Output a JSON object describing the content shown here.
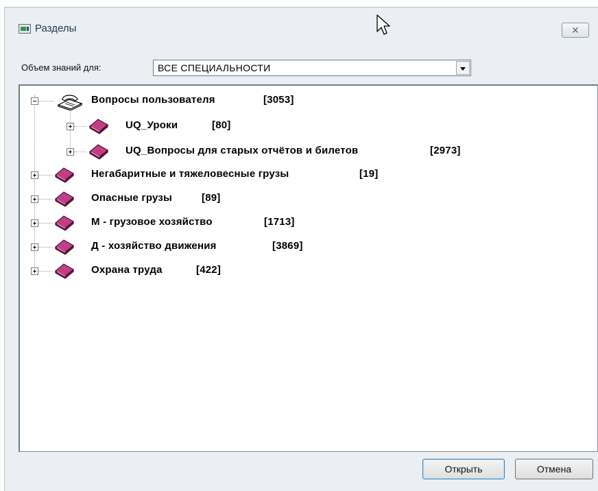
{
  "window": {
    "title": "Разделы",
    "close_symbol": "✕"
  },
  "scope": {
    "label": "Объем знаний для:",
    "selected": "ВСЕ СПЕЦИАЛЬНОСТИ"
  },
  "tree": {
    "root": {
      "label": "Вопросы пользователя",
      "count": "[3053]",
      "expanded": true,
      "icon": "telephone-icon"
    },
    "children": [
      {
        "label": "UQ_Уроки",
        "count": "[80]",
        "icon": "book-icon"
      },
      {
        "label": "UQ_Вопросы для старых отчётов и билетов",
        "count": "[2973]",
        "icon": "book-icon"
      }
    ],
    "items": [
      {
        "label": "Негабаритные и тяжеловесные грузы",
        "count": "[19]",
        "icon": "book-icon"
      },
      {
        "label": "Опасные грузы",
        "count": "[89]",
        "icon": "book-icon"
      },
      {
        "label": "М - грузовое хозяйство",
        "count": "[1713]",
        "icon": "book-icon"
      },
      {
        "label": "Д - хозяйство движения",
        "count": "[3869]",
        "icon": "book-icon"
      },
      {
        "label": "Охрана труда",
        "count": "[422]",
        "icon": "book-icon"
      }
    ]
  },
  "buttons": {
    "open": "Открыть",
    "cancel": "Отмена"
  },
  "colors": {
    "window_bg": "#ebeef2",
    "book": "#a31d66",
    "accent_border": "#3c7fb1"
  }
}
